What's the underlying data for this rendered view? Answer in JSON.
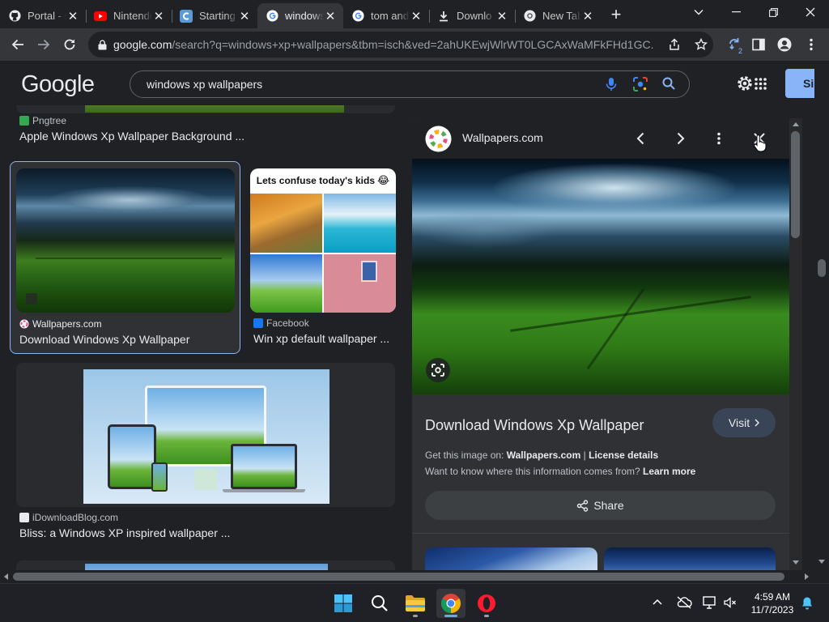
{
  "tabs": [
    {
      "title": "Portal - s",
      "icon": "github-icon",
      "active": false
    },
    {
      "title": "Nintendo",
      "icon": "youtube-icon",
      "active": false
    },
    {
      "title": "Starting",
      "icon": "c-circle-icon",
      "active": false
    },
    {
      "title": "windows",
      "icon": "google-icon",
      "active": true
    },
    {
      "title": "tom and",
      "icon": "google-icon",
      "active": false
    },
    {
      "title": "Downlo",
      "icon": "download-icon",
      "active": false
    },
    {
      "title": "New Tab",
      "icon": "chrome-icon",
      "active": false
    }
  ],
  "toolbar": {
    "url_host": "google.com",
    "url_rest": "/search?q=windows+xp+wallpapers&tbm=isch&ved=2ahUKEwjWlrWT0LGCAxWaMFkFHd1GC...",
    "extension_badge": "2"
  },
  "google": {
    "logo": "Google",
    "query": "windows xp wallpapers",
    "signin_label": "Si"
  },
  "results": {
    "top": {
      "source": "Pngtree",
      "title": "Apple Windows Xp Wallpaper Background ..."
    },
    "selected": {
      "source": "Wallpapers.com",
      "title": "Download Windows Xp Wallpaper"
    },
    "facebook": {
      "banner": "Lets confuse today's kids",
      "emoji": "😂",
      "source": "Facebook",
      "title": "Win xp default wallpaper ..."
    },
    "idownload": {
      "source": "iDownloadBlog.com",
      "title": "Bliss: a Windows XP inspired wallpaper ..."
    }
  },
  "panel": {
    "source": "Wallpapers.com",
    "title": "Download Windows Xp Wallpaper",
    "visit_label": "Visit",
    "get_image_prefix": "Get this image on: ",
    "get_image_site": "Wallpapers.com",
    "separator": " | ",
    "license": "License details",
    "want_to_know": "Want to know where this information comes from? ",
    "learn_more": "Learn more",
    "share_label": "Share"
  },
  "taskbar": {
    "time": "4:59 AM",
    "date": "11/7/2023"
  },
  "colors": {
    "page_bg": "#202124",
    "panel_bg": "#303134",
    "accent_blue": "#8ab4f8",
    "visit_bg": "#394457"
  }
}
